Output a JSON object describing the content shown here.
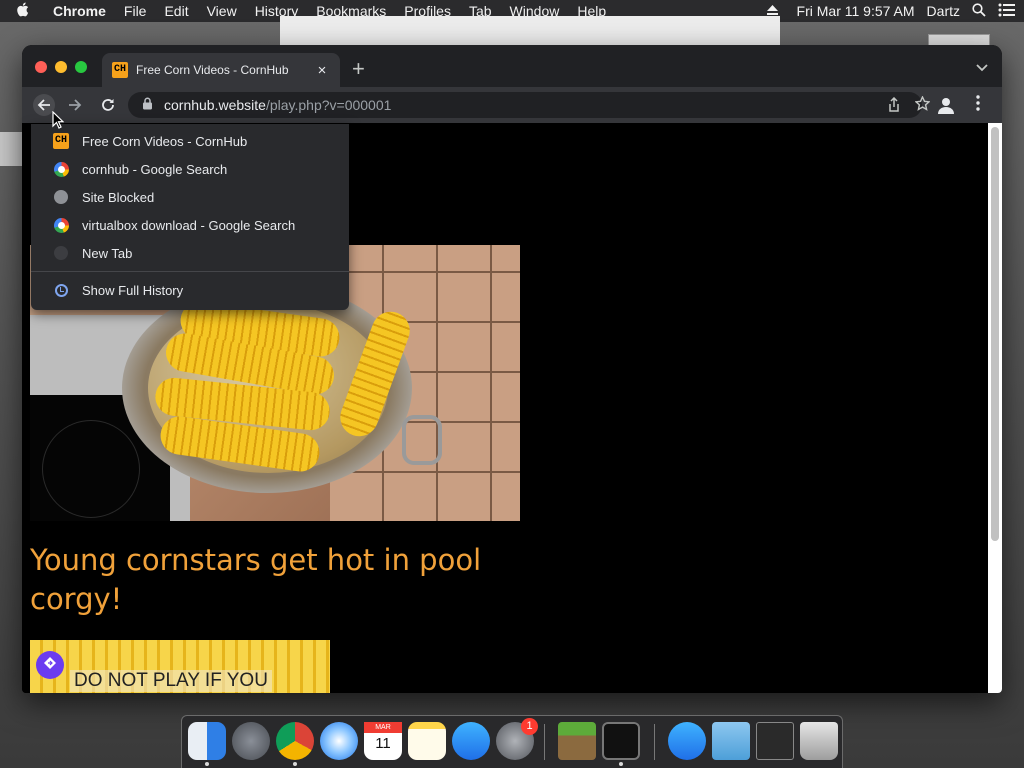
{
  "menubar": {
    "app_name": "Chrome",
    "items": [
      "File",
      "Edit",
      "View",
      "History",
      "Bookmarks",
      "Profiles",
      "Tab",
      "Window",
      "Help"
    ],
    "clock": "Fri Mar 11  9:57 AM",
    "user": "Dartz"
  },
  "tab": {
    "favicon_text": "CH",
    "title": "Free Corn Videos - CornHub",
    "close_glyph": "×",
    "new_tab_glyph": "+"
  },
  "omnibox": {
    "host": "cornhub.website",
    "path": "/play.php?v=000001"
  },
  "history_menu": {
    "items": [
      {
        "label": "Free Corn Videos - CornHub",
        "icon": "cornhub-favicon"
      },
      {
        "label": "cornhub - Google Search",
        "icon": "google-icon"
      },
      {
        "label": "Site Blocked",
        "icon": "globe-icon"
      },
      {
        "label": "virtualbox download - Google Search",
        "icon": "google-icon"
      },
      {
        "label": "New Tab",
        "icon": "new-tab-icon"
      }
    ],
    "show_full_history": "Show Full History"
  },
  "page": {
    "headline": "Young cornstars get hot in pool corgy!",
    "thumbnail_caption": "DO NOT PLAY IF YOU"
  },
  "dock": {
    "calendar_month": "MAR",
    "calendar_day": "11",
    "settings_badge": "1"
  },
  "colors": {
    "headline": "#f0a13a",
    "cornhub_brand": "#f7a21b",
    "chrome_toolbar": "#35363a"
  }
}
